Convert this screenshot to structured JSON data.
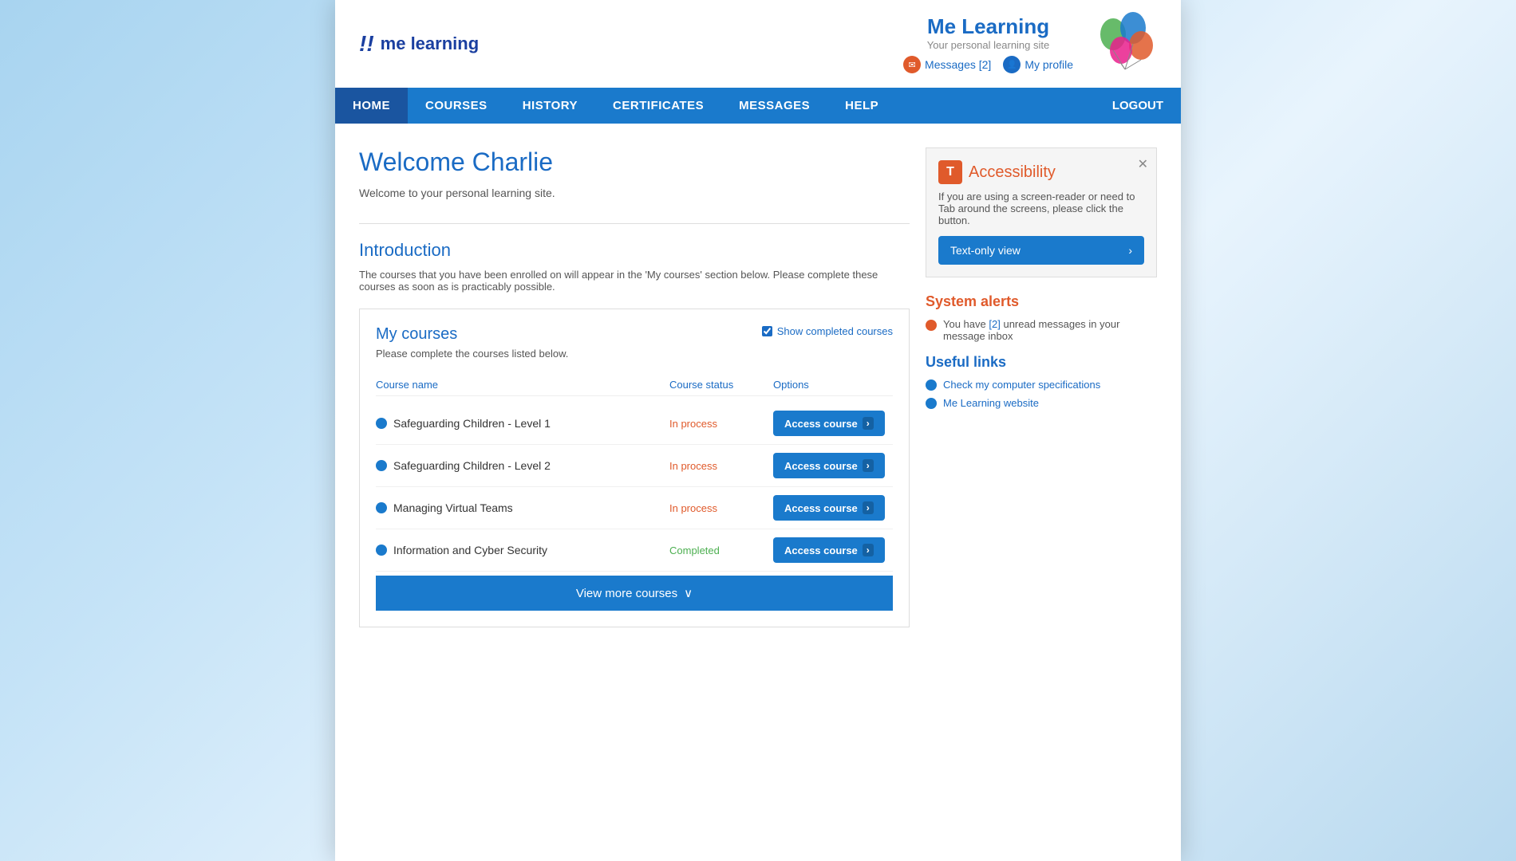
{
  "logo": {
    "mark": "!!",
    "text": "me learning"
  },
  "site": {
    "name": "Me Learning",
    "tagline": "Your personal learning site",
    "messages_label": "Messages [2]",
    "profile_label": "My profile"
  },
  "nav": {
    "items": [
      {
        "label": "HOME",
        "active": true
      },
      {
        "label": "COURSES",
        "active": false
      },
      {
        "label": "HISTORY",
        "active": false
      },
      {
        "label": "CERTIFICATES",
        "active": false
      },
      {
        "label": "MESSAGES",
        "active": false
      },
      {
        "label": "HELP",
        "active": false
      }
    ],
    "logout_label": "LOGOUT"
  },
  "welcome": {
    "heading": "Welcome Charlie",
    "subtitle": "Welcome to your personal learning site."
  },
  "introduction": {
    "title": "Introduction",
    "text": "The courses that you have been enrolled on will appear in the 'My courses' section below. Please complete these courses as soon as is practicably possible."
  },
  "my_courses": {
    "title": "My courses",
    "subtitle": "Please complete the courses listed below.",
    "show_completed_label": "Show completed courses",
    "col_name": "Course name",
    "col_status": "Course status",
    "col_options": "Options",
    "courses": [
      {
        "name": "Safeguarding Children - Level 1",
        "status": "In process",
        "status_type": "inprocess",
        "btn_label": "Access course"
      },
      {
        "name": "Safeguarding Children - Level 2",
        "status": "In process",
        "status_type": "inprocess",
        "btn_label": "Access course"
      },
      {
        "name": "Managing Virtual Teams",
        "status": "In process",
        "status_type": "inprocess",
        "btn_label": "Access course"
      },
      {
        "name": "Information and Cyber Security",
        "status": "Completed",
        "status_type": "completed",
        "btn_label": "Access course"
      }
    ],
    "view_more_label": "View more courses"
  },
  "accessibility": {
    "icon_label": "T",
    "title": "Accessibility",
    "description": "If you are using a screen-reader or need to Tab around the screens, please click the button.",
    "btn_label": "Text-only view"
  },
  "system_alerts": {
    "title": "System alerts",
    "alert_text": "You have",
    "alert_count": "[2]",
    "alert_text2": "unread messages in your message inbox"
  },
  "useful_links": {
    "title": "Useful links",
    "links": [
      {
        "label": "Check my computer specifications"
      },
      {
        "label": "Me Learning website"
      }
    ]
  }
}
